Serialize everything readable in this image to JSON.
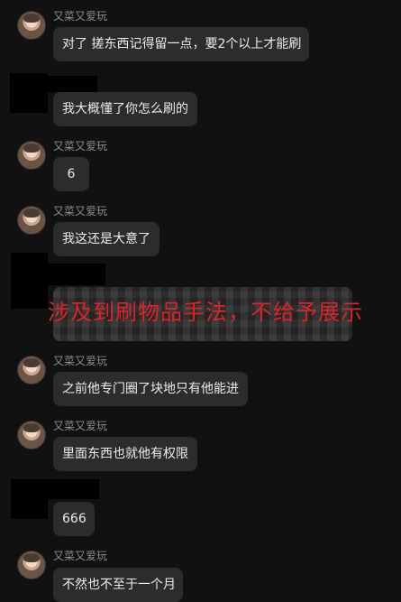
{
  "sender_name": "又菜又爱玩",
  "messages": [
    {
      "text": "对了 搓东西记得留一点，要2个以上才能刷"
    },
    {
      "text": "我大概懂了你怎么刷的"
    },
    {
      "text": "6"
    },
    {
      "text": "我这还是大意了"
    },
    {
      "text": "之前他专门圈了块地只有他能进"
    },
    {
      "text": "里面东西也就他有权限"
    },
    {
      "text": "666"
    },
    {
      "text": "不然也不至于一个月"
    }
  ],
  "overlay_text": "涉及到刷物品手法，不给予展示",
  "colors": {
    "background": "#111111",
    "bubble": "#2c2c2c",
    "overlay": "#d7262b"
  }
}
